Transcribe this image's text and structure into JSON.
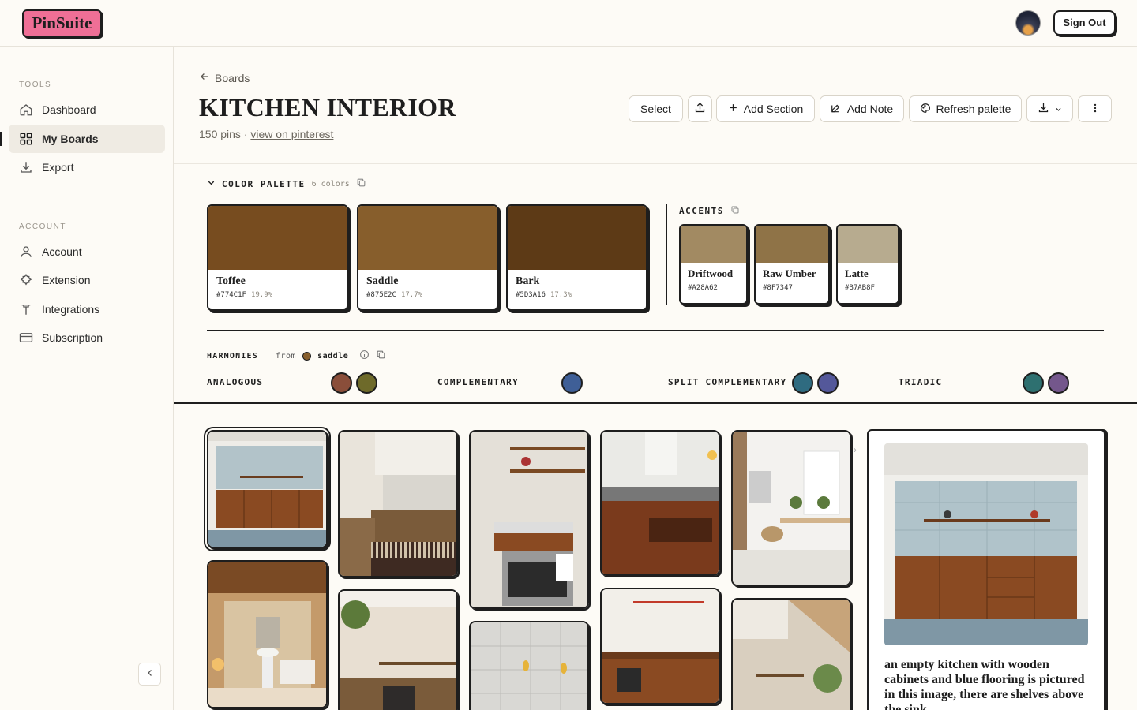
{
  "app": {
    "logo": "PinSuite",
    "signout": "Sign Out"
  },
  "sidebar": {
    "tools_label": "TOOLS",
    "account_label": "ACCOUNT",
    "items": [
      {
        "label": "Dashboard",
        "icon": "home-icon"
      },
      {
        "label": "My Boards",
        "icon": "grid-icon",
        "active": true
      },
      {
        "label": "Export",
        "icon": "download-icon"
      },
      {
        "label": "Account",
        "icon": "user-icon"
      },
      {
        "label": "Extension",
        "icon": "puzzle-icon"
      },
      {
        "label": "Integrations",
        "icon": "plug-icon"
      },
      {
        "label": "Subscription",
        "icon": "card-icon"
      }
    ]
  },
  "header": {
    "breadcrumb": "Boards",
    "title": "KITCHEN INTERIOR",
    "meta_count": "150 pins · ",
    "meta_link": "view on pinterest",
    "buttons": {
      "select": "Select",
      "add_section": "Add Section",
      "add_note": "Add Note",
      "refresh": "Refresh palette"
    }
  },
  "palette": {
    "title": "COLOR PALETTE",
    "count": "6 colors",
    "main": [
      {
        "name": "Toffee",
        "hex": "#774C1F",
        "pct": "19.9%",
        "color": "#774C1F"
      },
      {
        "name": "Saddle",
        "hex": "#875E2C",
        "pct": "17.7%",
        "color": "#875E2C"
      },
      {
        "name": "Bark",
        "hex": "#5D3A16",
        "pct": "17.3%",
        "color": "#5D3A16"
      }
    ],
    "accents_title": "ACCENTS",
    "accents": [
      {
        "name": "Driftwood",
        "hex": "#A28A62",
        "color": "#A28A62"
      },
      {
        "name": "Raw Umber",
        "hex": "#8F7347",
        "color": "#8F7347"
      },
      {
        "name": "Latte",
        "hex": "#B7AB8F",
        "color": "#B7AB8F"
      }
    ]
  },
  "harmonies": {
    "title": "HARMONIES",
    "from_label": "from",
    "from_name": "saddle",
    "from_color": "#875E2C",
    "groups": [
      {
        "label": "ANALOGOUS",
        "colors": [
          "#8a4e3a",
          "#6e6a2a"
        ]
      },
      {
        "label": "COMPLEMENTARY",
        "colors": [
          "#3f5f97"
        ]
      },
      {
        "label": "SPLIT COMPLEMENTARY",
        "colors": [
          "#2f6b80",
          "#54589a"
        ]
      },
      {
        "label": "TRIADIC",
        "colors": [
          "#2e7070",
          "#74578c"
        ]
      }
    ]
  },
  "detail": {
    "description": "an empty kitchen with wooden cabinets and blue flooring is pictured in this image, there are shelves above the sink"
  }
}
